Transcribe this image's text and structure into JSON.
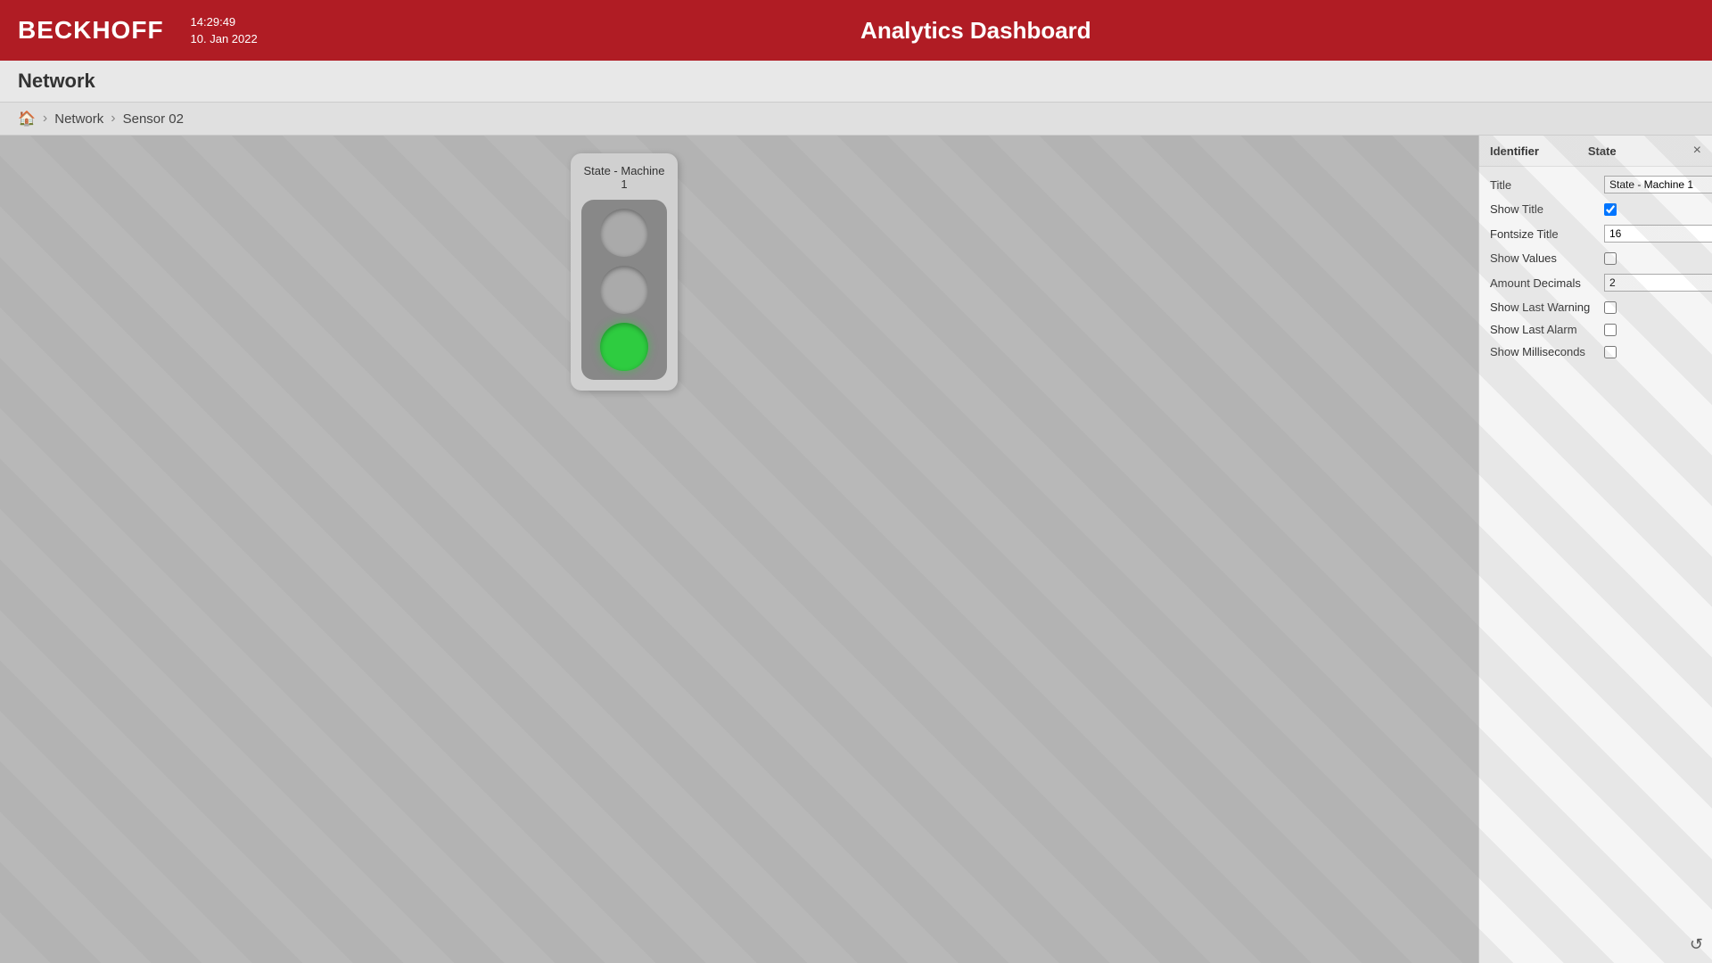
{
  "header": {
    "logo": "BECKHOFF",
    "datetime_line1": "14:29:49",
    "datetime_line2": "10. Jan 2022",
    "title": "Analytics Dashboard"
  },
  "sub_header": {
    "label": "Network"
  },
  "breadcrumb": {
    "home_icon": "🏠",
    "separator": "›",
    "network": "Network",
    "sensor": "Sensor 02"
  },
  "widget": {
    "title": "State - Machine 1",
    "lights": [
      "off",
      "off",
      "green"
    ]
  },
  "panel": {
    "col1": "Identifier",
    "col2": "State",
    "close_label": "×",
    "fields": {
      "title_label": "Title",
      "title_value": "State - Machine 1",
      "show_title_label": "Show Title",
      "show_title_checked": true,
      "fontsize_title_label": "Fontsize Title",
      "fontsize_title_value": "16",
      "show_values_label": "Show Values",
      "show_values_checked": false,
      "amount_decimals_label": "Amount Decimals",
      "amount_decimals_value": "2",
      "show_last_warning_label": "Show Last Warning",
      "show_last_warning_checked": false,
      "show_last_alarm_label": "Show Last Alarm",
      "show_last_alarm_checked": false,
      "show_milliseconds_label": "Show Milliseconds",
      "show_milliseconds_checked": false
    },
    "refresh_icon": "↺"
  }
}
